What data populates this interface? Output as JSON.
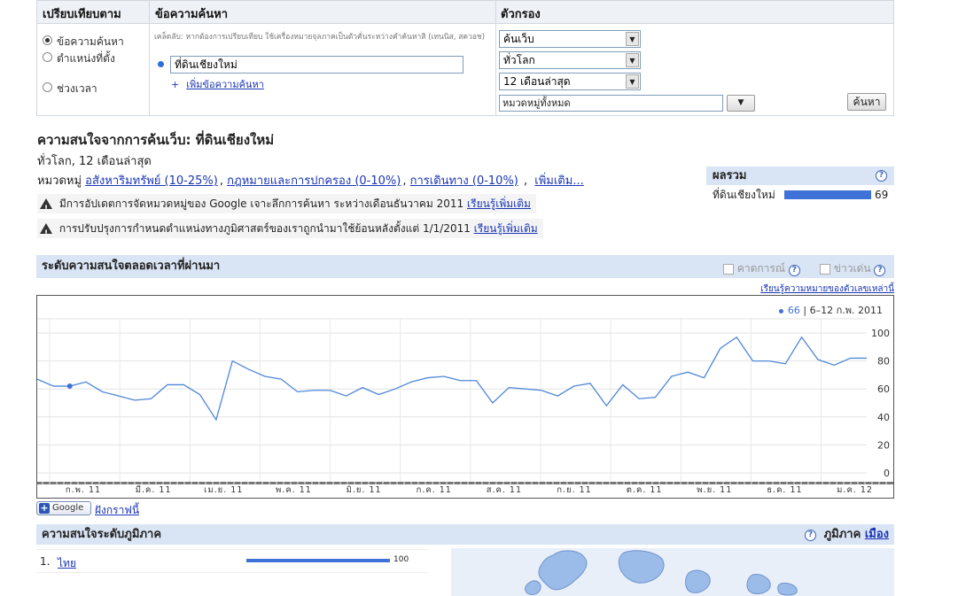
{
  "compare": {
    "col1_title": "เปรียบเทียบตาม",
    "col2_title": "ข้อความค้นหา",
    "col3_title": "ตัวกรอง",
    "options": [
      "ข้อความค้นหา",
      "ตำแหน่งที่ตั้ง",
      "ช่วงเวลา"
    ],
    "hint": "เคล็ดลับ: หากต้องการเปรียบเทียบ ใช้เครื่องหมายจุลภาคเป็นตัวคั่นระหว่างคำค้นหาสิ (เทนนิส, สควอช)",
    "term_value": "ที่ดินเชียงใหม่",
    "add_term": "เพิ่มข้อความค้นหา",
    "add_plus": "+",
    "filter_type": "ค้นเว็บ",
    "filter_region": "ทั่วโลก",
    "filter_time": "12 เดือนล่าสุด",
    "filter_category": "หมวดหมู่ทั้งหมด",
    "search_label": "ค้นหา"
  },
  "summary": {
    "title": "ความสนใจจากการค้นเว็บ: ที่ดินเชียงใหม่",
    "subtitle": "ทั่วโลก, 12 เดือนล่าสุด",
    "categories_prefix": "หมวดหมู่",
    "categories": [
      "อสังหาริมทรัพย์ (10-25%)",
      "กฎหมายและการปกครอง (0-10%)",
      "การเดินทาง (0-10%)"
    ],
    "more": "เพิ่มเติม...",
    "warning1": "มีการอัปเดตการจัดหมวดหมู่ของ Google เจาะลึกการค้นหา ระหว่างเดือนธันวาคม 2011",
    "warning2": "การปรับปรุงการกำหนดตำแหน่งทางภูมิศาสตร์ของเราถูกนำมาใช้ย้อนหลังตั้งแต่ 1/1/2011",
    "learn_more": "เรียนรู้เพิ่มเติม"
  },
  "totals": {
    "title": "ผลรวม",
    "term": "ที่ดินเชียงใหม่",
    "value": 69
  },
  "interest_over_time": {
    "title": "ระดับความสนใจตลอดเวลาที่ผ่านมา",
    "forecast": "คาดการณ์",
    "news": "ข่าวเด่น",
    "learn_link": "เรียนรู้ความหมายของตัวเลขเหล่านี้",
    "legend_value": "66",
    "legend_range": "| 6–12 ก.พ. 2011",
    "google_btn": "Google",
    "embed": "ฝังกราฟนี้"
  },
  "chart_data": {
    "type": "line",
    "title": "",
    "series": [
      {
        "values": [
          67,
          62,
          62,
          65,
          58,
          55,
          52,
          53,
          63,
          63,
          56,
          38,
          80,
          74,
          69,
          67,
          58,
          59,
          59,
          55,
          61,
          56,
          60,
          65,
          68,
          69,
          66,
          66,
          50,
          61,
          60,
          59,
          55,
          62,
          64,
          48,
          63,
          53,
          54,
          69,
          72,
          68,
          89,
          97,
          80,
          80,
          78,
          97,
          81,
          77,
          82,
          82
        ]
      }
    ],
    "x_ticks": [
      "ก.พ. 11",
      "มี.ค. 11",
      "เม.ย. 11",
      "พ.ค. 11",
      "มิ.ย. 11",
      "ก.ค. 11",
      "ส.ค. 11",
      "ก.ย. 11",
      "ต.ค. 11",
      "พ.ย. 11",
      "ธ.ค. 11",
      "ม.ค. 12"
    ],
    "y_ticks": [
      "100",
      "80",
      "60",
      "40",
      "20",
      "0"
    ],
    "ylim": [
      0,
      100
    ],
    "grid": true,
    "highlight_index": 2,
    "line_color": "#4f87d9"
  },
  "regional": {
    "title": "ความสนใจระดับภูมิภาค",
    "region_label": "ภูมิภาค",
    "city_link": "เมือง",
    "rows": [
      {
        "rank": "1.",
        "name": "ไทย",
        "value": 100
      }
    ]
  }
}
